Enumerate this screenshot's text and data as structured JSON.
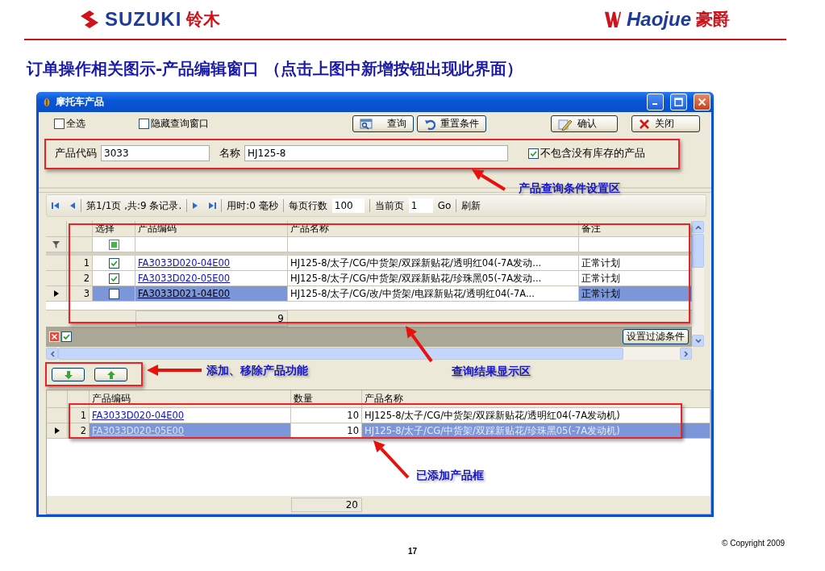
{
  "header": {
    "left_logo": {
      "name": "SUZUKI",
      "local_name": "铃木"
    },
    "right_logo": {
      "name": "Haojue",
      "local_name": "豪爵"
    }
  },
  "slide_title": "订单操作相关图示-产品编辑窗口 （点击上图中新增按钮出现此界面）",
  "window": {
    "title": "摩托车产品"
  },
  "toolbar": {
    "checkboxes": [
      {
        "label": "全选",
        "checked": false
      },
      {
        "label": "隐藏查询窗口",
        "checked": false
      }
    ],
    "buttons": [
      {
        "label": "查询",
        "kind": "search"
      },
      {
        "label": "重置条件",
        "kind": "reset"
      },
      {
        "label": "确认",
        "kind": "confirm"
      },
      {
        "label": "关闭",
        "kind": "close"
      }
    ]
  },
  "query": {
    "fields": [
      {
        "label": "产品代码",
        "value": "3033"
      },
      {
        "label": "名称",
        "value": "HJ125-8"
      }
    ],
    "option": {
      "label": "不包含没有库存的产品",
      "checked": true
    }
  },
  "pager": {
    "page_info": "第1/1页 ,共:9 条记录.",
    "elapsed": "用时:0 毫秒",
    "rows_per_page_label": "每页行数",
    "rows_per_page": "100",
    "current_page_label": "当前页",
    "current_page": "1",
    "go": "Go",
    "refresh": "刷新"
  },
  "results": {
    "columns": [
      "选择",
      "产品编码",
      "产品名称",
      "备注"
    ],
    "rows": [
      {
        "index": "1",
        "checked": true,
        "code": "FA3033D020-04E00",
        "name": "HJ125-8/太子/CG/中货架/双踩新贴花/透明红04(-7A发动...",
        "note": "正常计划",
        "selected": false
      },
      {
        "index": "2",
        "checked": true,
        "code": "FA3033D020-05E00",
        "name": "HJ125-8/太子/CG/中货架/双踩新贴花/珍珠黑05(-7A发动...",
        "note": "正常计划",
        "selected": false
      },
      {
        "index": "3",
        "checked": false,
        "code": "FA3033D021-04E00",
        "name": "HJ125-8/太子/CG/改/中货架/电踩新贴花/透明红04(-7A...",
        "note": "正常计划",
        "selected": true
      }
    ],
    "total": "9",
    "filter_checkbox": {
      "mixed": true
    },
    "filter_button": "设置过滤条件"
  },
  "added": {
    "columns": [
      "产品编码",
      "数量",
      "产品名称"
    ],
    "rows": [
      {
        "index": "1",
        "code": "FA3033D020-04E00",
        "quantity": "10",
        "name": "HJ125-8/太子/CG/中货架/双踩新贴花/透明红04(-7A发动机)",
        "selected": false
      },
      {
        "index": "2",
        "code": "FA3033D020-05E00",
        "quantity": "10",
        "name": "HJ125-8/太子/CG/中货架/双踩新贴花/珍珠黑05(-7A发动机)",
        "selected": true
      }
    ],
    "total": "20"
  },
  "annotations": [
    "产品查询条件设置区",
    "添加、移除产品功能",
    "查询结果显示区",
    "已添加产品框"
  ],
  "footer": {
    "copyright": "© Copyright 2009",
    "page_number": "17"
  }
}
